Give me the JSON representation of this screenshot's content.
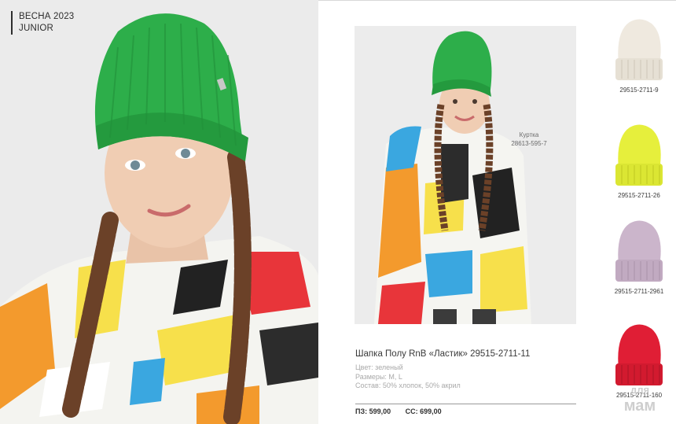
{
  "hero": {
    "season_line1": "ВЕСНА 2023",
    "season_line2": "JUNIOR"
  },
  "jacket_label": {
    "name": "Куртка",
    "code": "28613-595-7"
  },
  "product": {
    "title": "Шапка Полу RnB «Ластик» 29515-2711-11",
    "color": "Цвет: зеленый",
    "sizes": "Размеры: M, L",
    "composition": "Состав: 50% хлопок, 50% акрил",
    "price_pz": "ПЗ: 599,00",
    "price_ss": "СС: 699,00"
  },
  "thumbnails": [
    {
      "code": "29515-2711-9",
      "color": "#efe9df"
    },
    {
      "code": "29515-2711-26",
      "color": "#e6ef3c"
    },
    {
      "code": "29515-2711-2961",
      "color": "#cbb5cb"
    },
    {
      "code": "29515-2711-160",
      "color": "#e01e35"
    }
  ],
  "hat_color": "#2dae4a",
  "watermark": {
    "line1": "для",
    "line2": "мам"
  }
}
